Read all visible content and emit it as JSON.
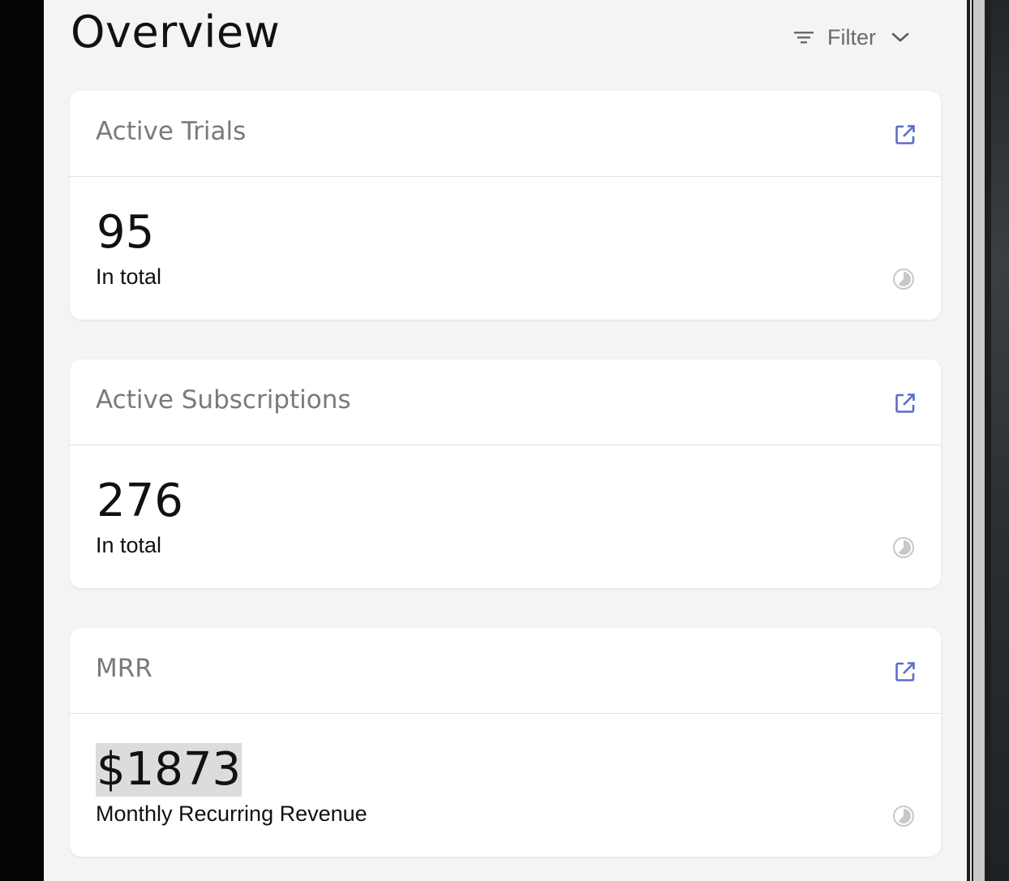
{
  "page": {
    "title": "Overview",
    "filter_label": "Filter"
  },
  "cards": [
    {
      "title": "Active Trials",
      "value": "95",
      "caption": "In total"
    },
    {
      "title": "Active Subscriptions",
      "value": "276",
      "caption": "In total"
    },
    {
      "title": "MRR",
      "value": "$1873",
      "caption": "Monthly Recurring Revenue"
    }
  ],
  "icons": {
    "filter": "filter-icon",
    "chevron": "chevron-down-icon",
    "open": "open-in-new-icon",
    "chart": "pie-chart-icon"
  },
  "colors": {
    "accent": "#5b6cc9",
    "muted_icon": "#c8c8c8",
    "panel_bg": "#f4f4f4",
    "selection_bg": "#dcdcdc"
  }
}
